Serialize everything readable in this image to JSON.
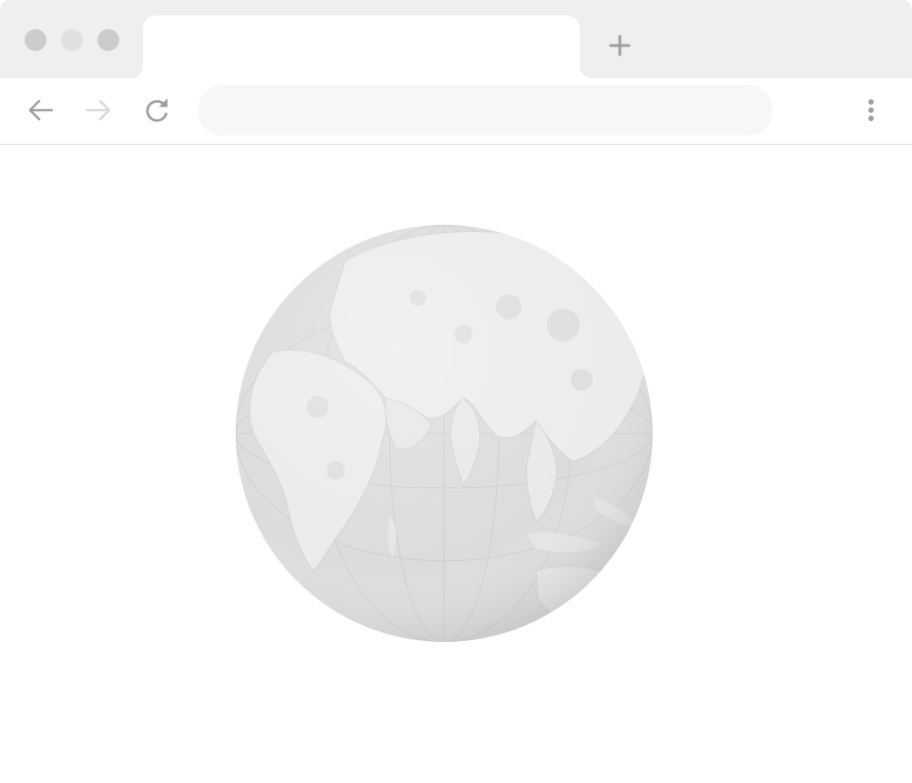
{
  "window": {
    "controls": [
      "close",
      "minimize",
      "zoom"
    ]
  },
  "tabs": [
    {
      "title": "",
      "active": true
    }
  ],
  "toolbar": {
    "new_tab_icon": "plus-icon",
    "back_icon": "arrow-left-icon",
    "forward_icon": "arrow-right-icon",
    "forward_enabled": false,
    "reload_icon": "reload-icon",
    "menu_icon": "kebab-menu-icon"
  },
  "address_bar": {
    "value": "",
    "placeholder": ""
  },
  "content": {
    "image": "globe-illustration",
    "image_alt": ""
  },
  "colors": {
    "tabstrip_bg": "#efefef",
    "omnibox_bg": "#f7f7f7",
    "icon_gray": "#9e9e9e",
    "icon_disabled": "#d8d8d8",
    "ocean": "#dcdcdc",
    "land": "#ececec"
  }
}
